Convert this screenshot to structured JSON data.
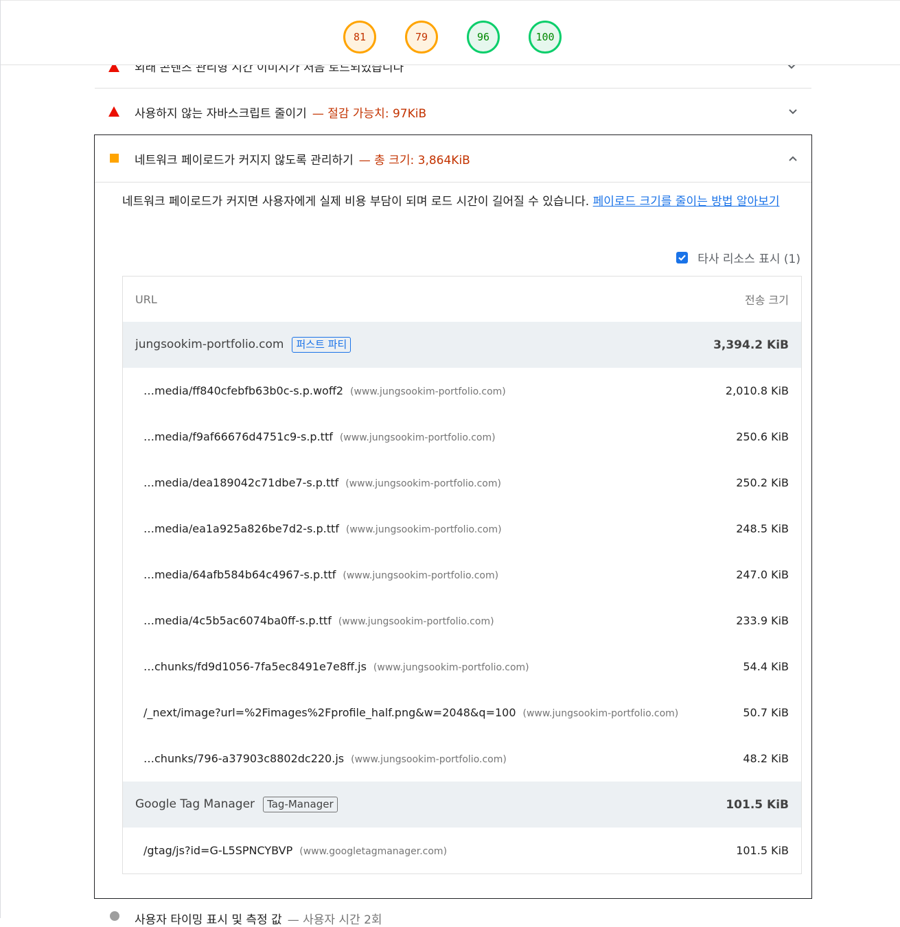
{
  "scores": [
    "81",
    "79",
    "96",
    "100"
  ],
  "prev_audit": {
    "title": "외래 콘텐츠 관리형 시간 이미지가 처음 로드되었습니다"
  },
  "audit_unused_js": {
    "title": "사용하지 않는 자바스크립트 줄이기",
    "detail": "— 절감 가능치: 97KiB"
  },
  "audit_payload": {
    "title": "네트워크 페이로드가 커지지 않도록 관리하기",
    "detail": "— 총 크기: 3,864KiB",
    "description": "네트워크 페이로드가 커지면 사용자에게 실제 비용 부담이 되며 로드 시간이 길어질 수 있습니다. ",
    "learn_more": "페이로드 크기를 줄이는 방법 알아보기",
    "third_party_label": "타사 리소스 표시 (1)",
    "table": {
      "col_url": "URL",
      "col_size": "전송 크기",
      "groups": [
        {
          "name": "jungsookim-portfolio.com",
          "badge": "퍼스트 파티",
          "size": "3,394.2 KiB",
          "rows": [
            {
              "url": "…media/ff840cfebfb63b0c-s.p.woff2",
              "host": "(www.jungsookim-portfolio.com)",
              "size": "2,010.8 KiB"
            },
            {
              "url": "…media/f9af66676d4751c9-s.p.ttf",
              "host": "(www.jungsookim-portfolio.com)",
              "size": "250.6 KiB"
            },
            {
              "url": "…media/dea189042c71dbe7-s.p.ttf",
              "host": "(www.jungsookim-portfolio.com)",
              "size": "250.2 KiB"
            },
            {
              "url": "…media/ea1a925a826be7d2-s.p.ttf",
              "host": "(www.jungsookim-portfolio.com)",
              "size": "248.5 KiB"
            },
            {
              "url": "…media/64afb584b64c4967-s.p.ttf",
              "host": "(www.jungsookim-portfolio.com)",
              "size": "247.0 KiB"
            },
            {
              "url": "…media/4c5b5ac6074ba0ff-s.p.ttf",
              "host": "(www.jungsookim-portfolio.com)",
              "size": "233.9 KiB"
            },
            {
              "url": "…chunks/fd9d1056-7fa5ec8491e7e8ff.js",
              "host": "(www.jungsookim-portfolio.com)",
              "size": "54.4 KiB"
            },
            {
              "url": "/_next/image?url=%2Fimages%2Fprofile_half.png&w=2048&q=100",
              "host": "(www.jungsookim-portfolio.com)",
              "size": "50.7 KiB"
            },
            {
              "url": "…chunks/796-a37903c8802dc220.js",
              "host": "(www.jungsookim-portfolio.com)",
              "size": "48.2 KiB"
            }
          ]
        },
        {
          "name": "Google Tag Manager",
          "badge": "Tag-Manager",
          "size": "101.5 KiB",
          "rows": [
            {
              "url": "/gtag/js?id=G-L5SPNCYBVP",
              "host": "(www.googletagmanager.com)",
              "size": "101.5 KiB"
            }
          ]
        }
      ]
    }
  },
  "next_audit": {
    "title": "사용자 타이밍 표시 및 측정 값",
    "detail": "— 사용자 시간 2회"
  },
  "colors": {
    "fail": "#eb0f00",
    "average": "#ffa400",
    "pass": "#0cce6b",
    "link": "#1a73e8"
  }
}
